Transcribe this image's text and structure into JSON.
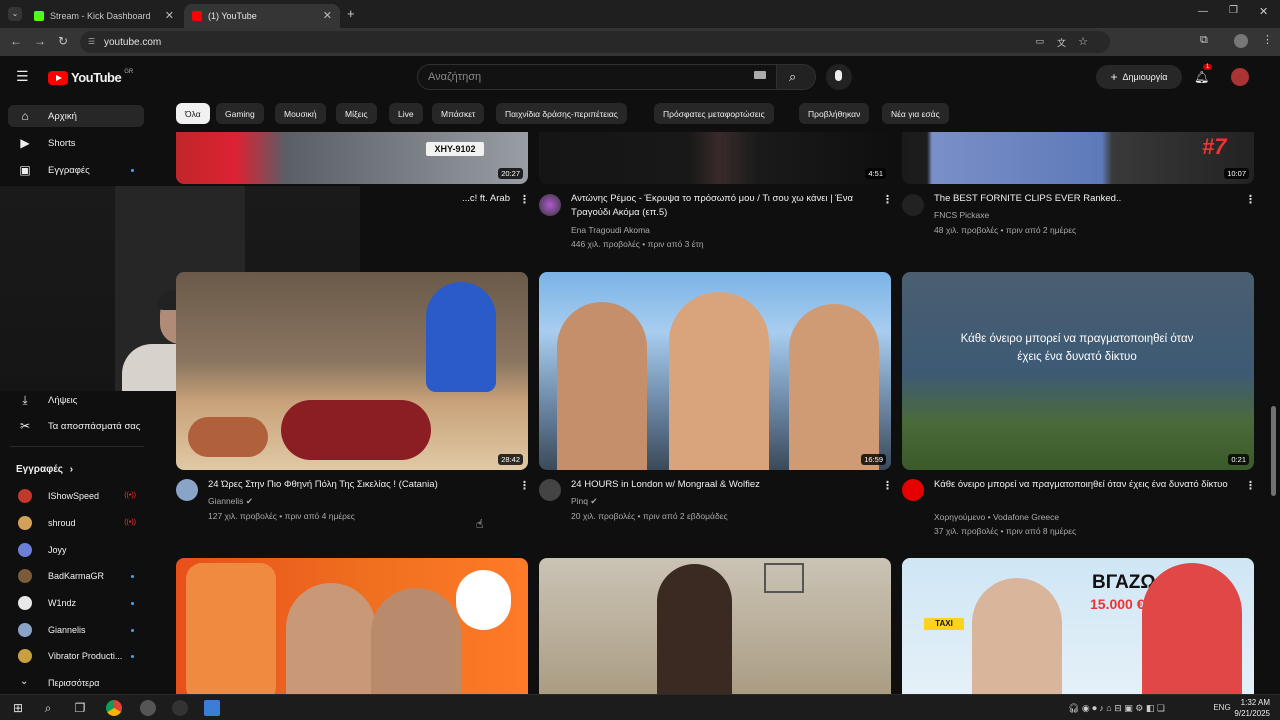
{
  "browser": {
    "tabs": [
      {
        "title": "Stream - Kick Dashboard",
        "favicon_color": "#53fc18"
      },
      {
        "title": "(1) YouTube",
        "favicon_color": "#ff0000"
      }
    ],
    "url": "youtube.com"
  },
  "youtube": {
    "logo_text": "YouTube",
    "logo_region": "GR",
    "search_placeholder": "Αναζήτηση",
    "create_label": "Δημιουργία",
    "notification_count": "1",
    "sidebar": {
      "items": [
        {
          "label": "Αρχική",
          "icon": "home-icon"
        },
        {
          "label": "Shorts",
          "icon": "shorts-icon"
        },
        {
          "label": "Εγγραφές",
          "icon": "subscriptions-icon"
        },
        {
          "label": "Λήψεις",
          "icon": "download-icon"
        },
        {
          "label": "Τα αποσπάσματά σας",
          "icon": "scissors-icon"
        }
      ],
      "subscriptions_header": "Εγγραφές",
      "subscriptions": [
        {
          "name": "IShowSpeed",
          "status": "live",
          "color": "#c0392b"
        },
        {
          "name": "shroud",
          "status": "live",
          "color": "#d4a05a"
        },
        {
          "name": "Joyy",
          "status": "",
          "color": "#6b7fd6"
        },
        {
          "name": "BadKarmaGR",
          "status": "new",
          "color": "#7a5c3a"
        },
        {
          "name": "W1ndz",
          "status": "new",
          "color": "#e8e8e8"
        },
        {
          "name": "Giannelis",
          "status": "new",
          "color": "#8aa4c8"
        },
        {
          "name": "Vibrator Producti...",
          "status": "new",
          "color": "#c8a040"
        }
      ],
      "more_label": "Περισσότερα"
    },
    "chips": [
      "Όλα",
      "Gaming",
      "Μουσική",
      "Μίξεις",
      "Live",
      "Μπάσκετ",
      "Παιχνίδια δράσης-περιπέτειας",
      "Πρόσφατες μεταφορτώσεις",
      "Προβλήθηκαν",
      "Νέα για εσάς"
    ],
    "row1": [
      {
        "title": "...c! ft. Arab",
        "duration": "20:27"
      },
      {
        "title": "Αντώνης Ρέμος - Έκρυψα το πρόσωπό μου / Τι σου χω κάνει | Ένα Τραγούδι Ακόμα (επ.5)",
        "channel": "Ena Tragoudi Akoma",
        "meta": "446 χιλ. προβολές • πριν από 3 έτη",
        "duration": "4:51"
      },
      {
        "title": "The BEST FORNITE CLIPS EVER Ranked..",
        "channel": "FNCS Pickaxe",
        "meta": "48 χιλ. προβολές • πριν από 2 ημέρες",
        "duration": "10:07"
      }
    ],
    "row2": [
      {
        "title": "24 Ώρες Στην Πιο Φθηνή Πόλη Της Σικελίας ! (Catania)",
        "channel": "Giannelis",
        "meta": "127 χιλ. προβολές • πριν από 4 ημέρες",
        "duration": "28:42"
      },
      {
        "title": "24 HOURS in London w/ Mongraal & Wolfiez",
        "channel": "Pinq",
        "meta": "20 χιλ. προβολές • πριν από 2 εβδομάδες",
        "duration": "16:59"
      },
      {
        "title": "Κάθε όνειρο μπορεί να πραγματοποιηθεί όταν έχεις ένα δυνατό δίκτυο",
        "channel": "Χορηγούμενο • Vodafone Greece",
        "meta": "37 χιλ. προβολές • πριν από 8 ημέρες",
        "duration": "0:21",
        "overlay": "Κάθε όνειρο μπορεί να πραγματοποιηθεί όταν έχεις ένα δυνατό δίκτυο"
      }
    ],
    "row3": [
      {
        "thumb_text": ""
      },
      {
        "thumb_text": ""
      },
      {
        "thumb_text": "ΒΓΑΖΩ",
        "thumb_sub": "15.000 €",
        "taxi": "TAXI"
      }
    ],
    "fortnite_rank": "#7"
  },
  "taskbar": {
    "lang": "ENG",
    "time": "1:32 AM",
    "date": "9/21/2025"
  }
}
